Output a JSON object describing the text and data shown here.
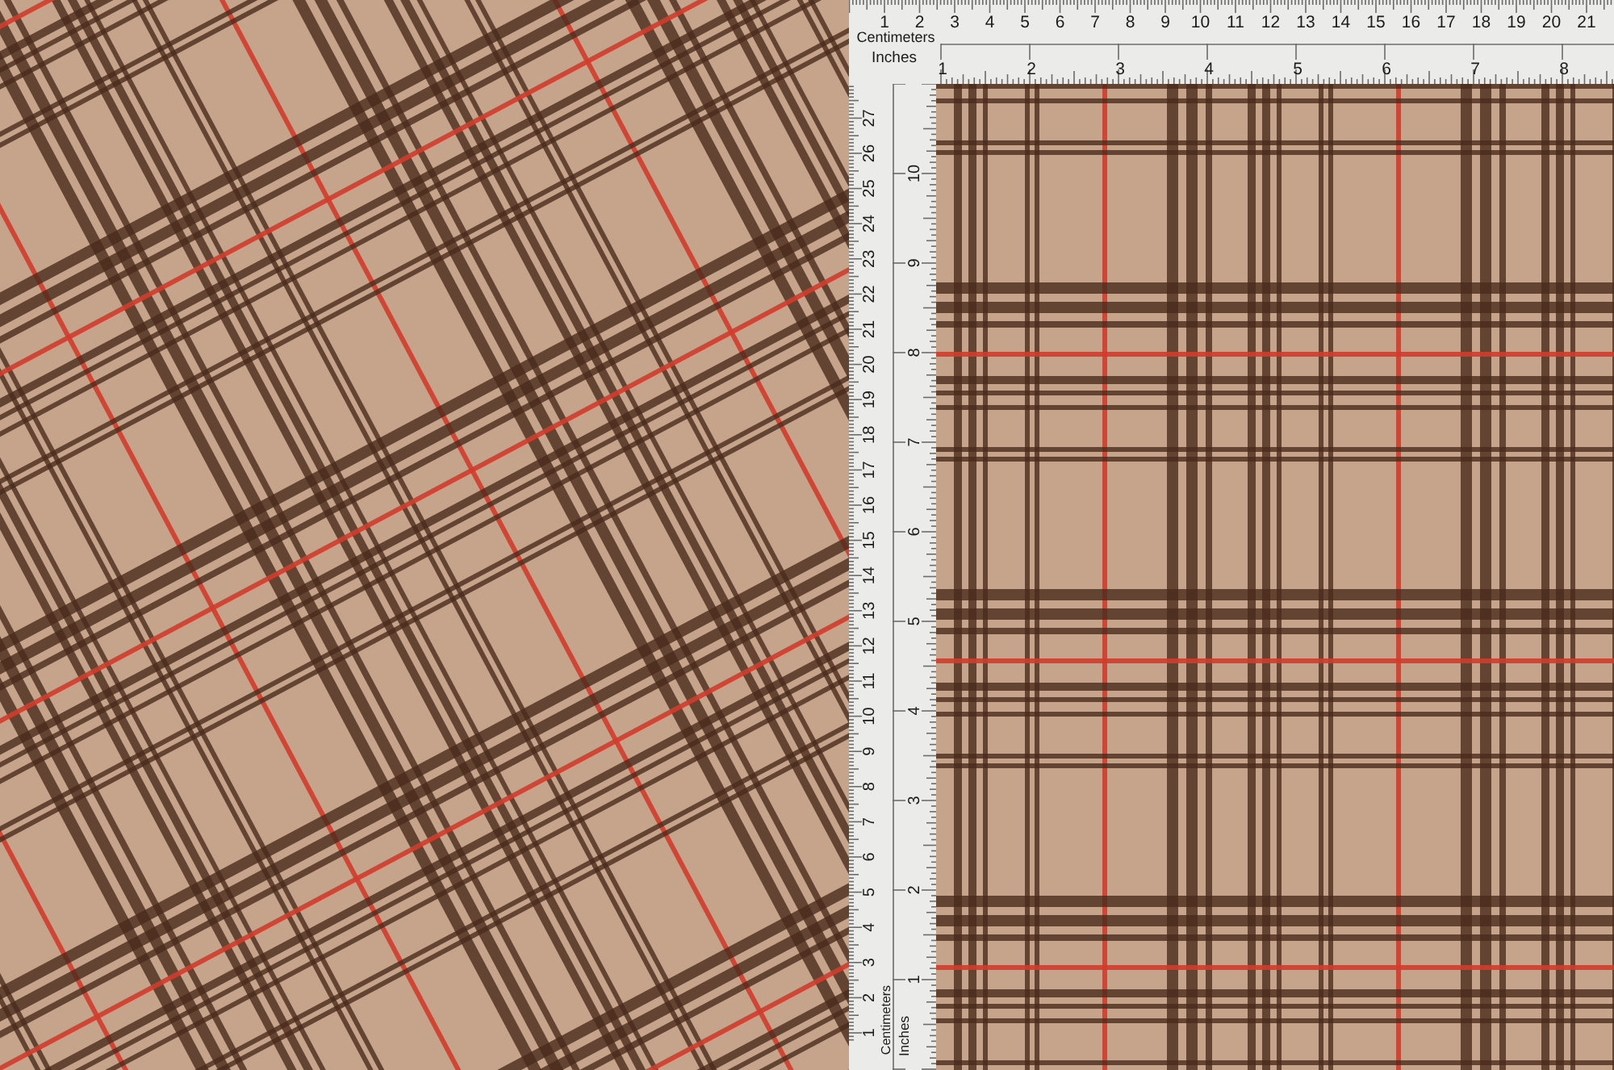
{
  "top_ruler": {
    "centimeter_numbers": [
      "1",
      "2",
      "3",
      "4",
      "5",
      "6",
      "7",
      "8",
      "9",
      "10",
      "11",
      "12",
      "13",
      "14",
      "15",
      "16",
      "17",
      "18",
      "19",
      "20",
      "21"
    ],
    "centimeters_label": "Centimeters",
    "inches_label": "Inches",
    "inch_numbers": [
      "1",
      "2",
      "3",
      "4",
      "5",
      "6",
      "7",
      "8"
    ]
  },
  "side_ruler": {
    "centimeter_numbers": [
      "1",
      "2",
      "3",
      "4",
      "5",
      "6",
      "7",
      "8",
      "9",
      "10",
      "11",
      "12",
      "13",
      "14",
      "15",
      "16",
      "17",
      "18",
      "19",
      "20",
      "21",
      "22",
      "23",
      "24",
      "25",
      "26",
      "27"
    ],
    "inch_numbers": [
      "1",
      "2",
      "3",
      "4",
      "5",
      "6",
      "7",
      "8",
      "9",
      "10"
    ],
    "centimeters_label": "Centimeters",
    "inches_label": "Inches"
  }
}
